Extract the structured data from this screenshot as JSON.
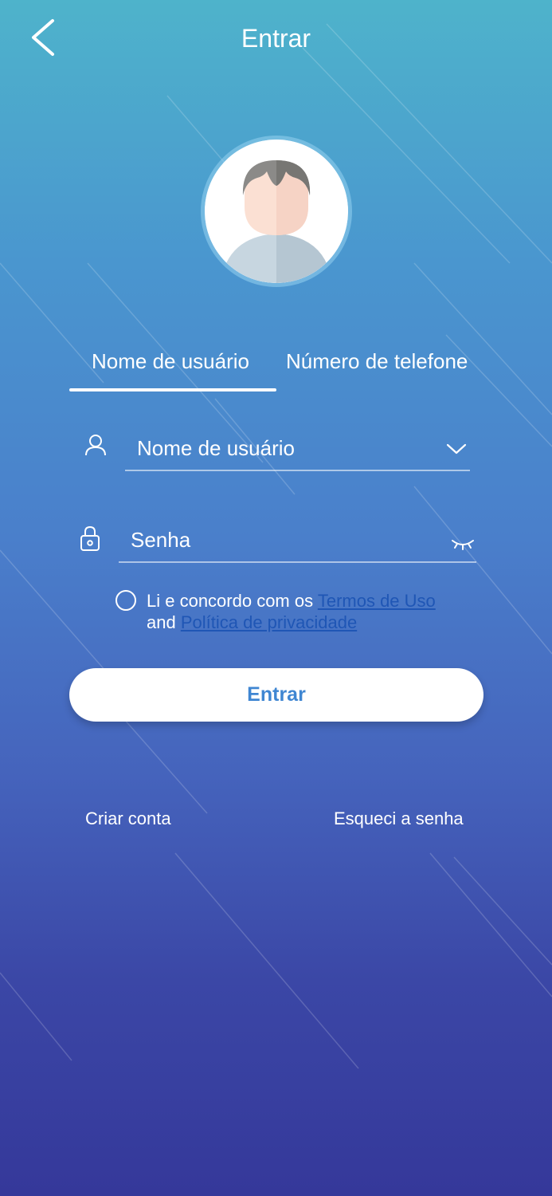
{
  "header": {
    "title": "Entrar",
    "back_icon": "chevron-left-icon"
  },
  "avatar": {
    "icon": "user-avatar-illustration"
  },
  "tabs": {
    "items": [
      {
        "label": "Nome de usuário",
        "active": true
      },
      {
        "label": "Número de telefone",
        "active": false
      }
    ]
  },
  "form": {
    "username": {
      "placeholder": "Nome de usuário",
      "value": "",
      "icon": "user-icon",
      "dropdown_icon": "chevron-down-icon"
    },
    "password": {
      "placeholder": "Senha",
      "value": "",
      "icon": "lock-icon",
      "toggle_icon": "eye-closed-icon"
    }
  },
  "agreement": {
    "checked": false,
    "prefix": "Li e concordo com os ",
    "terms_link": "Termos de Uso",
    "and_text": "and ",
    "privacy_link": "Política de privacidade"
  },
  "login_button": {
    "label": "Entrar"
  },
  "footer": {
    "create_account": "Criar conta",
    "forgot_password": "Esqueci a senha"
  },
  "colors": {
    "gradient_top": "#4eb3cb",
    "gradient_bottom": "#35389a",
    "button_text": "#3f86d2",
    "link": "#1f56b5"
  }
}
